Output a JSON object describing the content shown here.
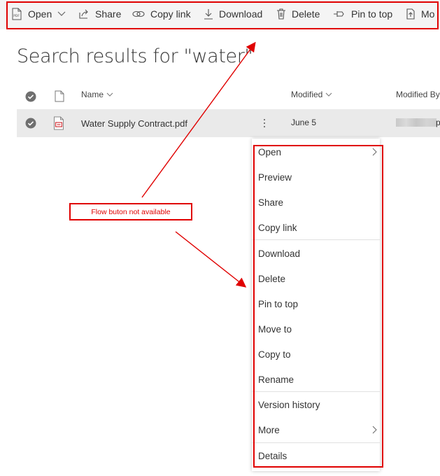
{
  "command_bar": {
    "open": "Open",
    "share": "Share",
    "copy_link": "Copy link",
    "download": "Download",
    "delete": "Delete",
    "pin_to_top": "Pin to top",
    "move": "Mo"
  },
  "page_title": "Search results for \"water\"",
  "columns": {
    "name": "Name",
    "modified": "Modified",
    "modified_by": "Modified By"
  },
  "file_row": {
    "name": "Water Supply Contract.pdf",
    "modified": "June 5",
    "modified_by_suffix": "p"
  },
  "context_menu": {
    "items": [
      "Open",
      "Preview",
      "Share",
      "Copy link",
      "Download",
      "Delete",
      "Pin to top",
      "Move to",
      "Copy to",
      "Rename",
      "Version history",
      "More",
      "Details"
    ]
  },
  "annotation": {
    "callout_text": "Flow buton not available",
    "color": "#e00000"
  }
}
